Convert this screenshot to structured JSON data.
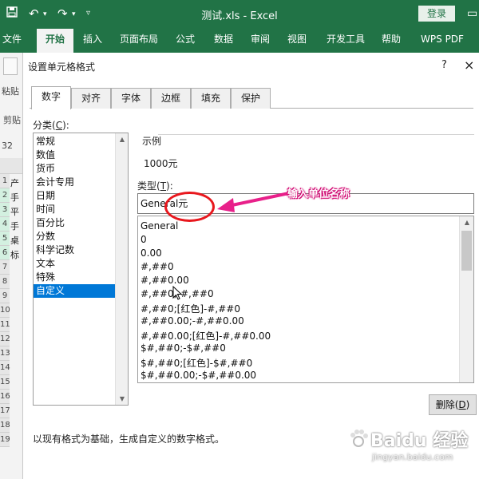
{
  "app": {
    "title": "测试.xls  -  Excel",
    "login": "登录",
    "undo_icon": "undo-icon",
    "redo_icon": "redo-icon",
    "save_icon": "save-icon"
  },
  "ribbon": {
    "tabs": [
      "文件",
      "开始",
      "插入",
      "页面布局",
      "公式",
      "数据",
      "审阅",
      "视图",
      "开发工具",
      "帮助",
      "WPS PDF"
    ],
    "active": "开始"
  },
  "background": {
    "paste": "粘贴",
    "clipboard": "剪贴",
    "name_box": "32",
    "rows": [
      {
        "num": "1",
        "cell": "产"
      },
      {
        "num": "2",
        "cell": "手"
      },
      {
        "num": "3",
        "cell": "平"
      },
      {
        "num": "4",
        "cell": "手"
      },
      {
        "num": "5",
        "cell": "桌"
      },
      {
        "num": "6",
        "cell": "标"
      },
      {
        "num": "7",
        "cell": ""
      },
      {
        "num": "8",
        "cell": ""
      },
      {
        "num": "9",
        "cell": ""
      },
      {
        "num": "10",
        "cell": ""
      },
      {
        "num": "11",
        "cell": ""
      },
      {
        "num": "12",
        "cell": ""
      },
      {
        "num": "13",
        "cell": ""
      },
      {
        "num": "14",
        "cell": ""
      },
      {
        "num": "15",
        "cell": ""
      },
      {
        "num": "16",
        "cell": ""
      },
      {
        "num": "17",
        "cell": ""
      },
      {
        "num": "18",
        "cell": ""
      },
      {
        "num": "19",
        "cell": ""
      }
    ]
  },
  "dialog": {
    "title": "设置单元格格式",
    "help": "?",
    "close": "×",
    "tabs": [
      "数字",
      "对齐",
      "字体",
      "边框",
      "填充",
      "保护"
    ],
    "active_tab": "数字",
    "category_label": "分类(",
    "category_key": "C",
    "category_label_end": "):",
    "categories": [
      "常规",
      "数值",
      "货币",
      "会计专用",
      "日期",
      "时间",
      "百分比",
      "分数",
      "科学记数",
      "文本",
      "特殊",
      "自定义"
    ],
    "selected_category": "自定义",
    "sample_label": "示例",
    "sample_value": "1000元",
    "type_label": "类型(",
    "type_key": "T",
    "type_label_end": "):",
    "type_value": "General元",
    "formats": [
      "General",
      "0",
      "0.00",
      "#,##0",
      "#,##0.00",
      "#,##0;-#,##0",
      "#,##0;[红色]-#,##0",
      "#,##0.00;-#,##0.00",
      "#,##0.00;[红色]-#,##0.00",
      "$#,##0;-$#,##0",
      "$#,##0;[红色]-$#,##0",
      "$#,##0.00;-$#,##0.00"
    ],
    "delete_label": "删除(",
    "delete_key": "D",
    "delete_label_end": ")",
    "description": "以现有格式为基础，生成自定义的数字格式。"
  },
  "annotation": {
    "text": "输入单位名称",
    "color": "#e8171d"
  },
  "watermark": {
    "main": "Baidu 经验",
    "sub": "jingyan.baidu.com"
  },
  "colors": {
    "excel_green": "#217346",
    "selection_blue": "#0078d7"
  }
}
